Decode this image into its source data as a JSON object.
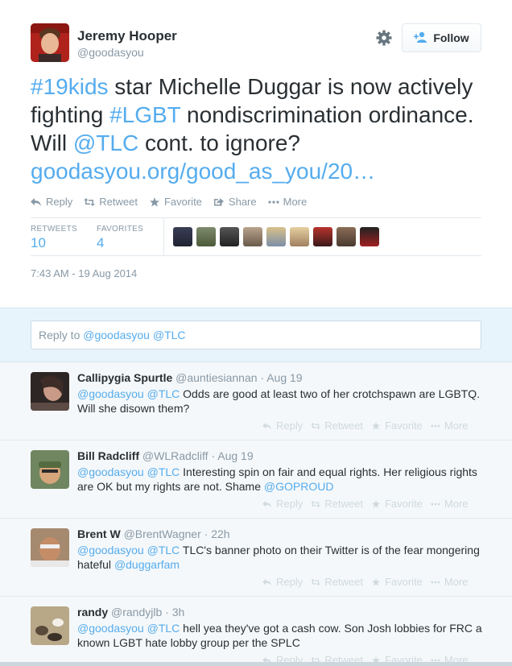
{
  "tweet": {
    "author_name": "Jeremy Hooper",
    "author_handle": "@goodasyou",
    "follow_label": "Follow",
    "text_parts": {
      "hashtag1": "#19kids",
      "t1": " star Michelle Duggar is now actively fighting ",
      "hashtag2": "#LGBT",
      "t2": " nondiscrimination ordinance.  Will ",
      "mention": "@TLC",
      "t3": " cont. to ignore? ",
      "url": "goodasyou.org/good_as_you/20…"
    },
    "actions": [
      "Reply",
      "Retweet",
      "Favorite",
      "Share",
      "More"
    ],
    "retweets_label": "RETWEETS",
    "retweets_count": "10",
    "favorites_label": "FAVORITES",
    "favorites_count": "4",
    "timestamp": "7:43 AM - 19 Aug 2014"
  },
  "reply_box": {
    "prefix": "Reply to ",
    "mentions": "@goodasyou @TLC"
  },
  "replies": [
    {
      "name": "Callipygia Spurtle",
      "handle": "@auntiesiannan",
      "time": "· Aug 19",
      "mentions": "@goodasyou @TLC",
      "text": " Odds are good at least two of her crotchspawn are LGBTQ. Will she disown them?",
      "mention2": "",
      "avatar_color": "#4a3a36"
    },
    {
      "name": "Bill Radcliff",
      "handle": "@WLRadcliff",
      "time": "· Aug 19",
      "mentions": "@goodasyou @TLC",
      "text": " Interesting spin on fair and equal rights. Her religious rights are OK but my rights are not. Shame ",
      "mention2": "@GOPROUD",
      "avatar_color": "#6c7b52"
    },
    {
      "name": "Brent W",
      "handle": "@BrentWagner",
      "time": "· 22h",
      "mentions": "@goodasyou @TLC",
      "text": " TLC's banner photo on their Twitter is of the fear mongering hateful ",
      "mention2": "@duggarfam",
      "avatar_color": "#8a6a52"
    },
    {
      "name": "randy",
      "handle": "@randyjlb",
      "time": "· 3h",
      "mentions": "@goodasyou @TLC",
      "text": " hell yea they've got a cash cow. Son Josh lobbies for FRC a known LGBT hate lobby group per the SPLC",
      "mention2": "",
      "avatar_color": "#9a8a6a"
    }
  ],
  "reply_actions": [
    "Reply",
    "Retweet",
    "Favorite",
    "More"
  ],
  "colors": {
    "link": "#55acee",
    "muted": "#8899a6",
    "text": "#292f33"
  }
}
